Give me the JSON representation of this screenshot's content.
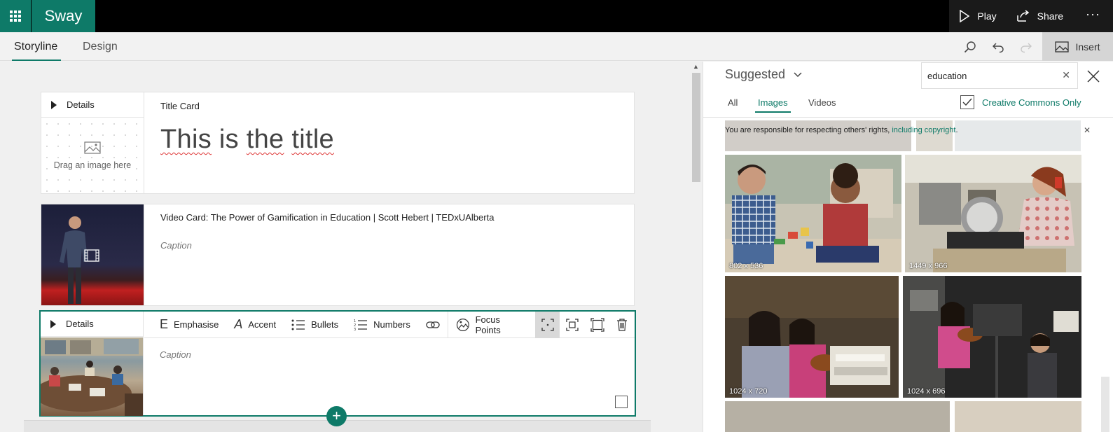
{
  "app": {
    "name": "Sway"
  },
  "topbar": {
    "play_label": "Play",
    "share_label": "Share",
    "more_label": "···"
  },
  "tabs": [
    {
      "label": "Storyline",
      "active": true
    },
    {
      "label": "Design",
      "active": false
    }
  ],
  "toolbar_right": {
    "insert_label": "Insert"
  },
  "cards": {
    "title_card": {
      "details_label": "Details",
      "dropzone_label": "Drag an image here",
      "type_label": "Title Card",
      "title_words": [
        "This",
        "is",
        "the",
        "title"
      ]
    },
    "video_card": {
      "type_label": "Video Card: The Power of Gamification in Education | Scott Hebert | TEDxUAlberta",
      "caption_placeholder": "Caption"
    },
    "image_card": {
      "details_label": "Details",
      "caption_placeholder": "Caption",
      "toolbar": {
        "emphasise": "Emphasise",
        "accent": "Accent",
        "bullets": "Bullets",
        "numbers": "Numbers",
        "focus_points": "Focus Points"
      }
    }
  },
  "panel": {
    "source_label": "Suggested",
    "search_value": "education",
    "tabs": [
      {
        "label": "All",
        "active": false
      },
      {
        "label": "Images",
        "active": true
      },
      {
        "label": "Videos",
        "active": false
      }
    ],
    "creative_commons_label": "Creative Commons Only",
    "creative_commons_checked": true,
    "notice_text": "You are responsible for respecting others' rights, ",
    "notice_link": "including copyright",
    "notice_end": ".",
    "images": [
      {
        "dims": "802 x 536",
        "subject": "children-playing-blocks"
      },
      {
        "dims": "1449 x 966",
        "subject": "student-using-saw"
      },
      {
        "dims": "1024 x 720",
        "subject": "girls-with-violins"
      },
      {
        "dims": "1024 x 696",
        "subject": "music-stands-class"
      }
    ]
  },
  "colors": {
    "accent": "#0e7a68",
    "topbar": "#000000",
    "squiggle": "#dd3333"
  }
}
